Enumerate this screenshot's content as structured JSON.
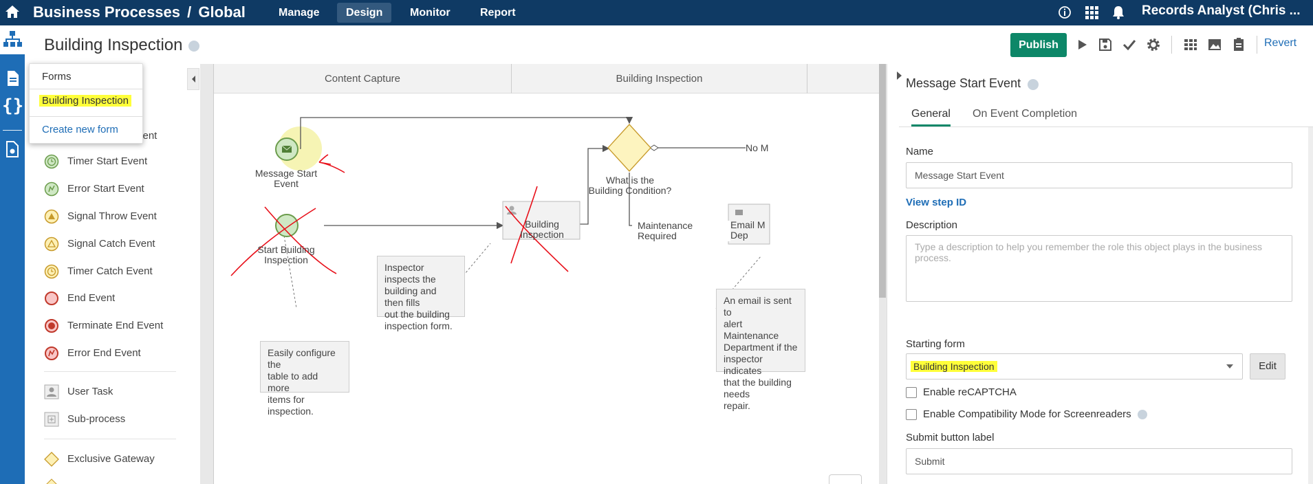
{
  "topbar": {
    "app_title": "Business Processes",
    "separator": "/",
    "scope": "Global",
    "nav": [
      "Manage",
      "Design",
      "Monitor",
      "Report"
    ],
    "active_nav": "Design",
    "user": "Records Analyst (Chris ..."
  },
  "header": {
    "title": "Building Inspection",
    "publish_label": "Publish",
    "revert_label": "Revert"
  },
  "forms_dropdown": {
    "heading": "Forms",
    "option": "Building Inspection",
    "create_new": "Create new form"
  },
  "palette": {
    "partial_item": "vent",
    "items": [
      {
        "label": "Timer Start Event",
        "icon": "timer-start-icon"
      },
      {
        "label": "Error Start Event",
        "icon": "error-start-icon"
      },
      {
        "label": "Signal Throw Event",
        "icon": "signal-throw-icon"
      },
      {
        "label": "Signal Catch Event",
        "icon": "signal-catch-icon"
      },
      {
        "label": "Timer Catch Event",
        "icon": "timer-catch-icon"
      },
      {
        "label": "End Event",
        "icon": "end-event-icon"
      },
      {
        "label": "Terminate End Event",
        "icon": "terminate-end-icon"
      },
      {
        "label": "Error End Event",
        "icon": "error-end-icon"
      },
      {
        "label": "User Task",
        "icon": "user-task-icon"
      },
      {
        "label": "Sub-process",
        "icon": "sub-process-icon"
      },
      {
        "label": "Exclusive Gateway",
        "icon": "exclusive-gateway-icon"
      }
    ]
  },
  "canvas": {
    "lanes": [
      "Content Capture",
      "Building Inspection"
    ],
    "message_start_label": "Message Start\nEvent",
    "start_building_label": "Start Building\nInspection",
    "task_label": "Building Inspection",
    "gateway_label": "What is the\nBuilding Condition?",
    "flow_no": "No M",
    "flow_maintenance": "Maintenance Required",
    "email_task_label": "Email M\nDep",
    "note_inspector": "Inspector inspects the\nbuilding and then fills\nout the building\ninspection form.",
    "note_table": "Easily configure the\ntable to add more\nitems for inspection.",
    "note_email": "An email is sent to\nalert Maintenance\nDepartment if the\ninspector indicates\nthat the building needs\nrepair."
  },
  "panel": {
    "title": "Message Start Event",
    "tabs": [
      "General",
      "On Event Completion"
    ],
    "name_label": "Name",
    "name_value": "Message Start Event",
    "view_step_id": "View step ID",
    "description_label": "Description",
    "description_placeholder": "Type a description to help you remember the role this object plays in the business process.",
    "starting_form_label": "Starting form",
    "starting_form_value": "Building Inspection",
    "edit_label": "Edit",
    "recaptcha_label": "Enable reCAPTCHA",
    "compat_label": "Enable Compatibility Mode for Screenreaders",
    "submit_label_label": "Submit button label",
    "submit_value": "Submit"
  },
  "colors": {
    "topbar": "#0f3a64",
    "rail": "#1e6db6",
    "publish": "#0d8768",
    "highlight": "#ffff3a",
    "annotation_red": "#e8101a"
  }
}
